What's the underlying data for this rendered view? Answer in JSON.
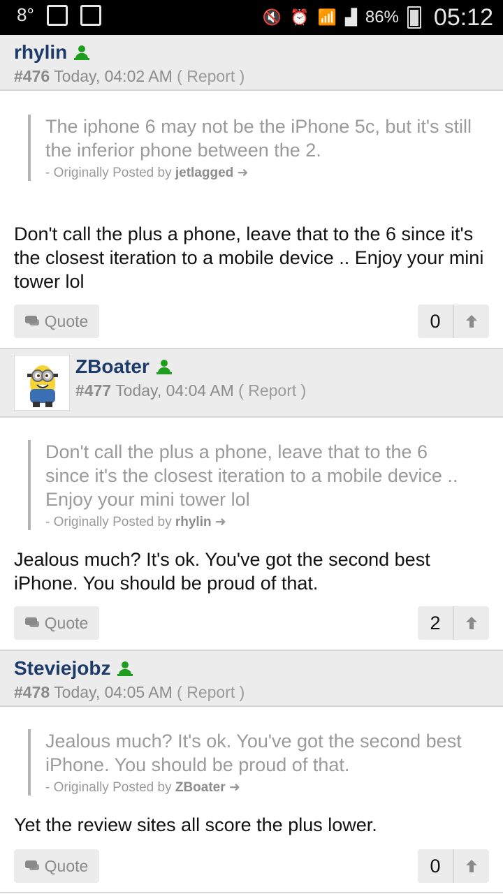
{
  "status_bar": {
    "temperature": "8°",
    "battery_percent": "86%",
    "time": "05:12"
  },
  "posts": [
    {
      "username": "rhylin",
      "post_number": "#476",
      "timestamp": "Today, 04:02 AM",
      "report_label": "Report",
      "quote": {
        "text": "The iphone 6 may not be the iPhone 5c, but it's still the inferior phone between the 2.",
        "attribution_prefix": "- Originally Posted by",
        "author": "jetlagged"
      },
      "body": "Don't call the plus a phone, leave that to the 6 since it's the closest iteration to a mobile device .. Enjoy your mini tower lol",
      "quote_button": "Quote",
      "votes": "0"
    },
    {
      "username": "ZBoater",
      "post_number": "#477",
      "timestamp": "Today, 04:04 AM",
      "report_label": "Report",
      "quote": {
        "text": "Don't call the plus a phone, leave that to the 6 since it's the closest iteration to a mobile device .. Enjoy your mini tower lol",
        "attribution_prefix": "- Originally Posted by",
        "author": "rhylin"
      },
      "body": "Jealous much? It's ok. You've got the second best iPhone. You should be proud of that.",
      "quote_button": "Quote",
      "votes": "2"
    },
    {
      "username": "Steviejobz",
      "post_number": "#478",
      "timestamp": "Today, 04:05 AM",
      "report_label": "Report",
      "quote": {
        "text": "Jealous much? It's ok. You've got the second best iPhone. You should be proud of that.",
        "attribution_prefix": "- Originally Posted by",
        "author": "ZBoater"
      },
      "body": "Yet the review sites all score the plus lower.",
      "quote_button": "Quote",
      "votes": "0"
    }
  ],
  "colors": {
    "username": "#1c3b6a",
    "online": "#1e9e1e",
    "header_bg": "#ececec"
  }
}
